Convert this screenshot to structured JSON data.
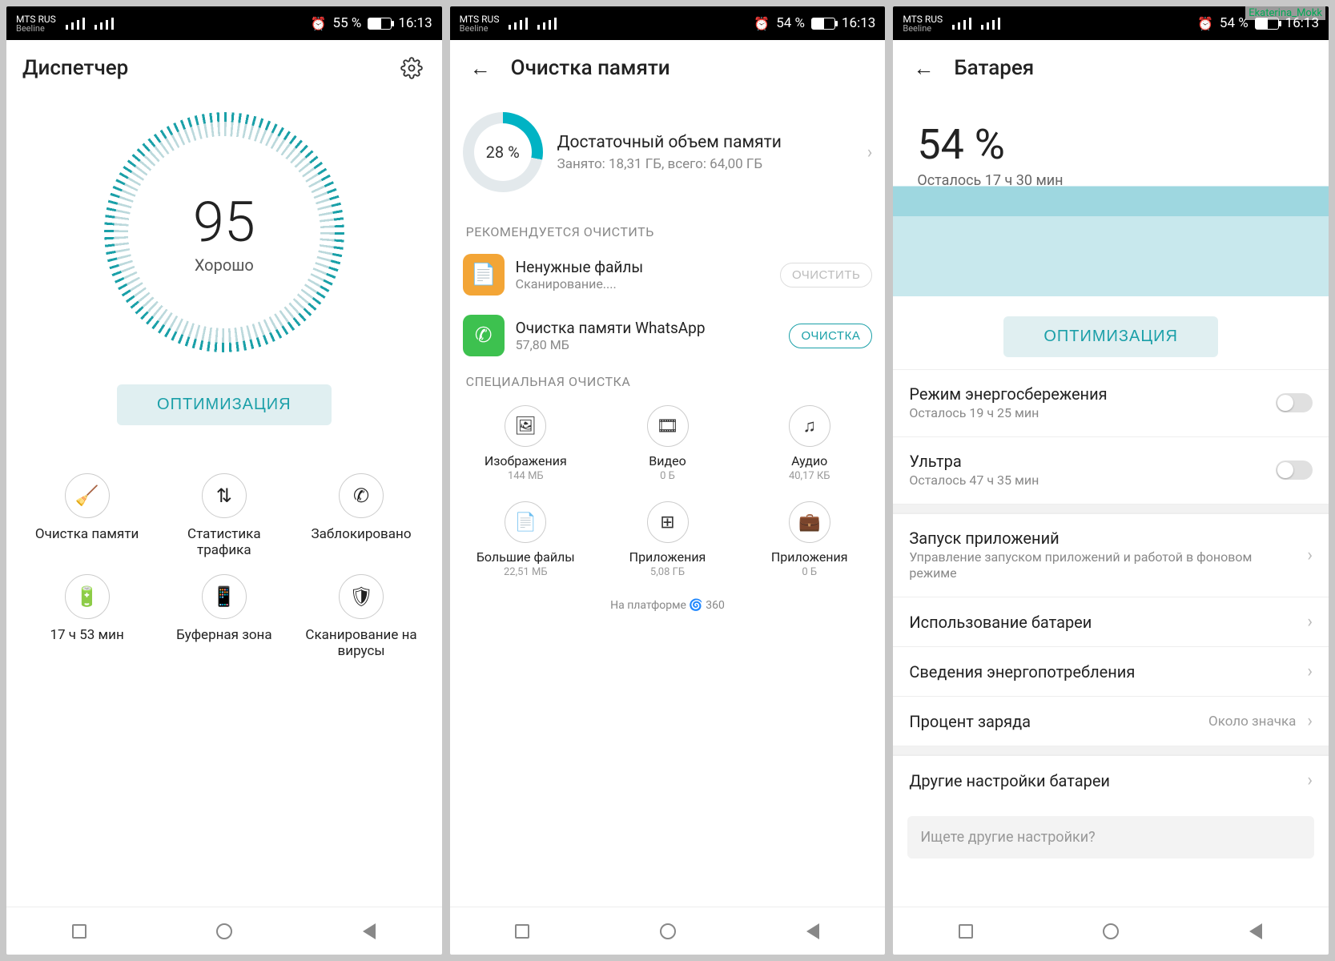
{
  "statusbar": {
    "carrier1": "MTS RUS",
    "carrier2": "Beeline",
    "alarm_icon": "⏰",
    "time": "16:13",
    "batt1": "55 %",
    "batt2": "54 %",
    "batt3": "54 %"
  },
  "screen1": {
    "title": "Диспетчер",
    "score": "95",
    "score_sub": "Хорошо",
    "optimize_btn": "ОПТИМИЗАЦИЯ",
    "tiles": [
      {
        "label": "Очистка памяти"
      },
      {
        "label": "Статистика трафика"
      },
      {
        "label": "Заблокировано"
      },
      {
        "label": "17 ч 53 мин"
      },
      {
        "label": "Буферная зона"
      },
      {
        "label": "Сканирование на вирусы"
      }
    ]
  },
  "screen2": {
    "title": "Очистка памяти",
    "storage_pct": "28 %",
    "storage_title": "Достаточный объем памяти",
    "storage_sub": "Занято: 18,31 ГБ, всего: 64,00 ГБ",
    "section_recommend": "РЕКОМЕНДУЕТСЯ ОЧИСТИТЬ",
    "rows": [
      {
        "title": "Ненужные файлы",
        "sub": "Сканирование....",
        "btn": "ОЧИСТИТЬ",
        "disabled": true
      },
      {
        "title": "Очистка памяти WhatsApp",
        "sub": "57,80 МБ",
        "btn": "ОЧИСТКА",
        "disabled": false
      }
    ],
    "section_special": "СПЕЦИАЛЬНАЯ ОЧИСТКА",
    "special": [
      {
        "label": "Изображения",
        "sub": "144 МБ"
      },
      {
        "label": "Видео",
        "sub": "0 Б"
      },
      {
        "label": "Аудио",
        "sub": "40,17 КБ"
      },
      {
        "label": "Большие файлы",
        "sub": "22,51 МБ"
      },
      {
        "label": "Приложения",
        "sub": "5,08 ГБ"
      },
      {
        "label": "Приложения",
        "sub": "0 Б"
      }
    ],
    "powered": "На платформе 🌀 360"
  },
  "screen3": {
    "title": "Батарея",
    "pct": "54 %",
    "remain": "Осталось 17 ч 30 мин",
    "optimize_btn": "ОПТИМИЗАЦИЯ",
    "rows": {
      "power_save_title": "Режим энергосбережения",
      "power_save_sub": "Осталось 19 ч 25 мин",
      "ultra_title": "Ультра",
      "ultra_sub": "Осталось 47 ч 35 мин",
      "launch_title": "Запуск приложений",
      "launch_sub": "Управление запуском приложений и работой в фоновом режиме",
      "usage": "Использование батареи",
      "details": "Сведения энергопотребления",
      "percent_title": "Процент заряда",
      "percent_val": "Около значка",
      "other": "Другие настройки батареи",
      "search_hint": "Ищете другие настройки?"
    }
  },
  "watermark": "Ekaterina_Mokk"
}
